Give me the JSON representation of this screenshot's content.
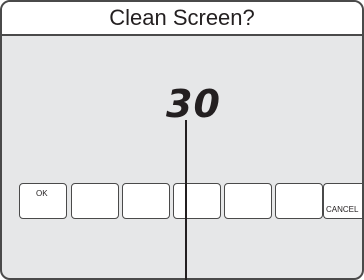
{
  "screen": {
    "title": "Clean Screen?",
    "countdown": "30"
  },
  "buttons": {
    "ok_label": "OK",
    "cancel_label": "CANCEL"
  }
}
